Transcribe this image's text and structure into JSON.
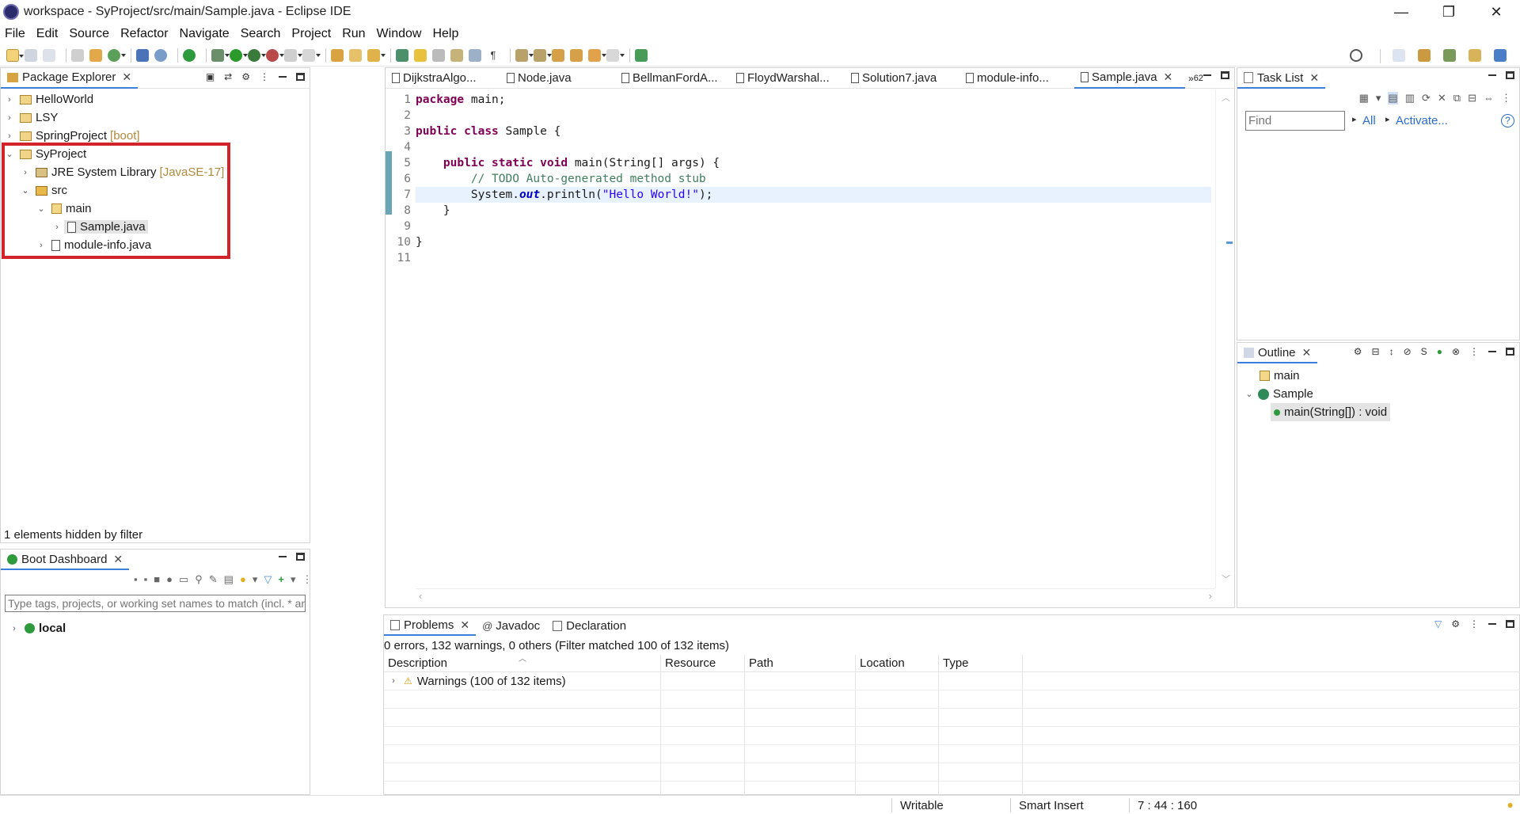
{
  "window": {
    "title": "workspace - SyProject/src/main/Sample.java - Eclipse IDE",
    "minimize": "—",
    "restore": "❐",
    "close": "✕"
  },
  "menu": [
    "File",
    "Edit",
    "Source",
    "Refactor",
    "Navigate",
    "Search",
    "Project",
    "Run",
    "Window",
    "Help"
  ],
  "package_explorer": {
    "tab_label": "Package Explorer",
    "tree": [
      {
        "label": "HelloWorld",
        "deco": "",
        "icon": "project-icon",
        "level": 0,
        "expanded": false
      },
      {
        "label": "LSY",
        "deco": "",
        "icon": "project-icon",
        "level": 0,
        "expanded": false
      },
      {
        "label": "SpringProject",
        "deco": "[boot]",
        "icon": "project-icon",
        "level": 0,
        "expanded": false
      },
      {
        "label": "SyProject",
        "deco": "",
        "icon": "project-icon",
        "level": 0,
        "expanded": true
      },
      {
        "label": "JRE System Library",
        "deco": "[JavaSE-17]",
        "icon": "library-icon",
        "level": 1,
        "expanded": false
      },
      {
        "label": "src",
        "deco": "",
        "icon": "source-folder-icon",
        "level": 1,
        "expanded": true
      },
      {
        "label": "main",
        "deco": "",
        "icon": "package-icon",
        "level": 2,
        "expanded": true
      },
      {
        "label": "Sample.java",
        "deco": "",
        "icon": "java-file-icon",
        "level": 3,
        "expanded": false,
        "selected": true
      },
      {
        "label": "module-info.java",
        "deco": "",
        "icon": "java-file-icon",
        "level": 2,
        "expanded": false
      }
    ],
    "footer": "1 elements hidden by filter"
  },
  "boot_dashboard": {
    "tab_label": "Boot Dashboard",
    "filter_placeholder": "Type tags, projects, or working set names to match (incl. * and ? wil",
    "local_label": "local"
  },
  "editor": {
    "tabs": [
      {
        "label": "DijkstraAlgo...",
        "active": false
      },
      {
        "label": "Node.java",
        "active": false
      },
      {
        "label": "BellmanFordA...",
        "active": false
      },
      {
        "label": "FloydWarshal...",
        "active": false
      },
      {
        "label": "Solution7.java",
        "active": false
      },
      {
        "label": "module-info...",
        "active": false
      },
      {
        "label": "Sample.java",
        "active": true
      }
    ],
    "overflow": "62",
    "line_numbers": [
      "1",
      "2",
      "3",
      "4",
      "5",
      "6",
      "7",
      "8",
      "9",
      "10",
      "11"
    ]
  },
  "task_list": {
    "tab_label": "Task List",
    "find_placeholder": "Find",
    "all_label": "All",
    "activate_label": "Activate...",
    "help": "?"
  },
  "outline": {
    "tab_label": "Outline",
    "items": [
      {
        "label": "main",
        "icon": "package-icon"
      },
      {
        "label": "Sample",
        "icon": "class-icon"
      },
      {
        "label": "main(String[]) : void",
        "icon": "method-icon"
      }
    ]
  },
  "bottom_tabs": [
    {
      "label": "Problems",
      "active": true,
      "icon": "problems-icon"
    },
    {
      "label": "Javadoc",
      "active": false,
      "icon": "javadoc-icon"
    },
    {
      "label": "Declaration",
      "active": false,
      "icon": "declaration-icon"
    }
  ],
  "problems": {
    "summary": "0 errors, 132 warnings, 0 others (Filter matched 100 of 132 items)",
    "columns": [
      "Description",
      "Resource",
      "Path",
      "Location",
      "Type"
    ],
    "rows": [
      {
        "description": "Warnings (100 of 132 items)"
      }
    ]
  },
  "status": {
    "writable": "Writable",
    "insert_mode": "Smart Insert",
    "position": "7 : 44 : 160"
  },
  "colors": {
    "highlight_box": "#d2232a",
    "accent": "#3d7fd8",
    "keyword": "#7f0055",
    "string": "#2a00ff",
    "comment": "#3f7f5f"
  }
}
